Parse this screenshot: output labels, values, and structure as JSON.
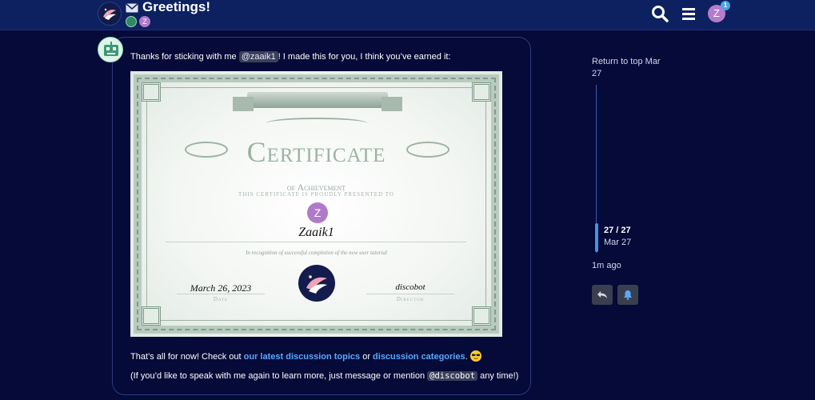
{
  "header": {
    "title": "Greetings!",
    "participants": [
      "Z"
    ],
    "user_initial": "Z",
    "notification_count": "1",
    "icons": [
      "site-logo",
      "envelope-icon",
      "search-icon",
      "menu-icon",
      "user-avatar"
    ]
  },
  "post": {
    "intro_before": "Thanks for sticking with me ",
    "mention": "@zaaik1",
    "intro_after": "! I made this for you, I think you’ve earned it:",
    "outro_before": "That’s all for now! Check out ",
    "link_topics": "our latest discussion topics",
    "outro_or": " or ",
    "link_categories": "discussion categories",
    "outro_period": ".",
    "help_before": "(If you’d like to speak with me again to learn more, just message or mention ",
    "help_code": "@discobot",
    "help_after": " any time!)",
    "emoji": "smiling-face-with-sunglasses"
  },
  "certificate": {
    "title": "Certificate",
    "subtitle": "of Achievement",
    "presented": "This certificate is proudly presented to",
    "avatar_initial": "Z",
    "name": "Zaaik1",
    "recognition": "In recognition of successful completion of the new user tutorial",
    "date": "March 26, 2023",
    "date_caption": "Date",
    "signature": "discobot",
    "signature_caption": "Director"
  },
  "timeline": {
    "return_top": "Return to top Mar 27",
    "count": "27 / 27",
    "date": "Mar 27",
    "ago": "1m ago",
    "buttons": [
      "reply-icon",
      "bell-icon"
    ]
  },
  "colors": {
    "background": "#050a38",
    "header": "#0d2060",
    "link": "#59a9ff",
    "avatar": "#b079c9",
    "timeline": "#4d8fe6"
  }
}
